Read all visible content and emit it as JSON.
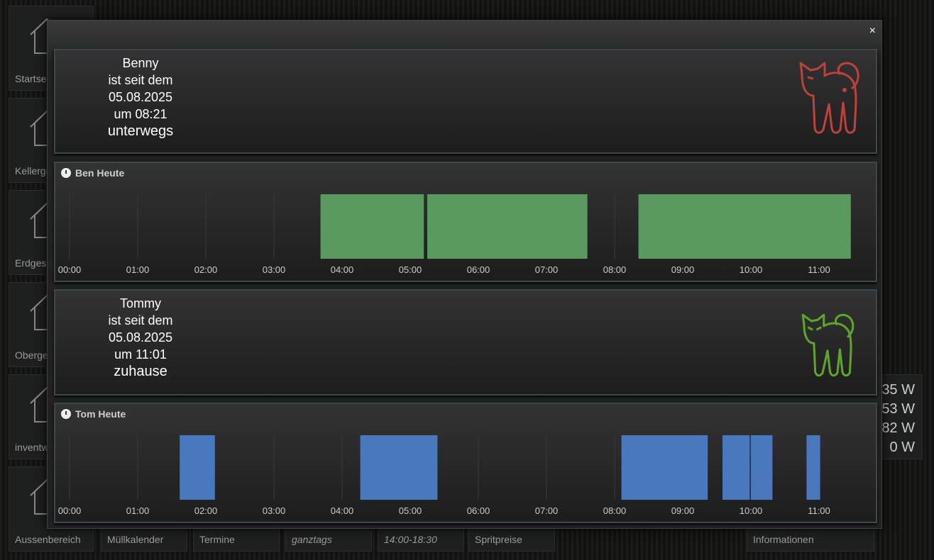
{
  "background": {
    "tiles": [
      "Startseite",
      "Kellergeschoss",
      "Erdgeschoss",
      "Obergeschoss",
      "inventwo",
      "Aussenbereich",
      "Müllkalender",
      "Termine",
      "ganztags",
      "14:00-18:30",
      "Spritpreise",
      "Informationen"
    ],
    "power": [
      "35 W",
      "53 W",
      "82 W",
      "0 W"
    ]
  },
  "modal": {
    "close_label": "×"
  },
  "benny": {
    "lines": [
      "Benny",
      "ist seit dem",
      "05.08.2025",
      "um 08:21"
    ],
    "state": "unterwegs",
    "cat_color": "#c0413b",
    "icon": "cat-icon"
  },
  "tommy": {
    "lines": [
      "Tommy",
      "ist seit dem",
      "05.08.2025",
      "um 11:01"
    ],
    "state": "zuhause",
    "cat_color": "#5da62a",
    "icon": "cat-icon"
  },
  "chart_data": [
    {
      "type": "timeline",
      "title": "Ben Heute",
      "color": "#5a9a5e",
      "xlim": [
        "00:00",
        "11:28"
      ],
      "ticks": [
        "00:00",
        "01:00",
        "02:00",
        "03:00",
        "04:00",
        "05:00",
        "06:00",
        "07:00",
        "08:00",
        "09:00",
        "10:00",
        "11:00"
      ],
      "segments": [
        [
          "03:41",
          "05:12"
        ],
        [
          "05:15",
          "07:36"
        ],
        [
          "08:21",
          "11:28"
        ]
      ]
    },
    {
      "type": "timeline",
      "title": "Tom Heute",
      "color": "#4a78bd",
      "xlim": [
        "00:00",
        "11:28"
      ],
      "ticks": [
        "00:00",
        "01:00",
        "02:00",
        "03:00",
        "04:00",
        "05:00",
        "06:00",
        "07:00",
        "08:00",
        "09:00",
        "10:00",
        "11:00"
      ],
      "segments": [
        [
          "01:37",
          "02:08"
        ],
        [
          "04:16",
          "05:24"
        ],
        [
          "08:06",
          "09:22"
        ],
        [
          "09:35",
          "09:59"
        ],
        [
          "10:00",
          "10:19"
        ],
        [
          "10:49",
          "11:01"
        ]
      ]
    }
  ]
}
